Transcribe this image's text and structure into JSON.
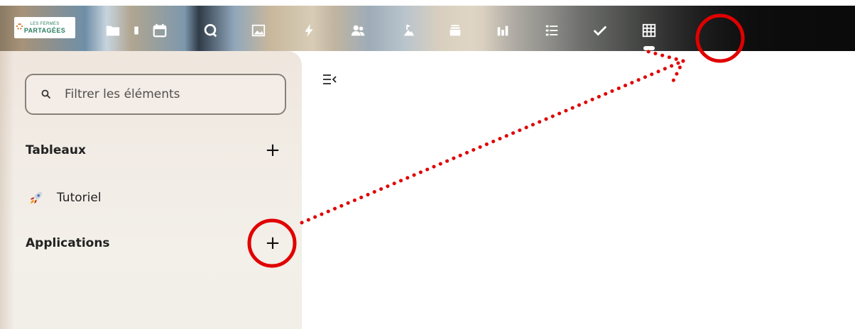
{
  "app": {
    "logo": {
      "line1": "LES FERMES",
      "line2": "PARTAGÉES"
    }
  },
  "nav": {
    "items": [
      {
        "name": "files-icon"
      },
      {
        "name": "calendar-icon"
      },
      {
        "name": "talk-icon"
      },
      {
        "name": "photos-icon"
      },
      {
        "name": "activity-icon"
      },
      {
        "name": "contacts-icon"
      },
      {
        "name": "maps-icon"
      },
      {
        "name": "deck-icon"
      },
      {
        "name": "analytics-icon"
      },
      {
        "name": "tasks-icon"
      },
      {
        "name": "checkmark-icon"
      },
      {
        "name": "tables-icon",
        "active": true
      }
    ]
  },
  "sidebar": {
    "search": {
      "placeholder": "Filtrer les éléments"
    },
    "tables_section": {
      "title": "Tableaux",
      "add_label": "+"
    },
    "items": [
      {
        "emoji": "🚀",
        "label": "Tutoriel"
      }
    ],
    "apps_section": {
      "title": "Applications",
      "add_label": "+"
    }
  },
  "colors": {
    "annotation": "#e00000",
    "sidebar_bg": "#f1ebe4",
    "logo_text": "#2a7d5f"
  }
}
